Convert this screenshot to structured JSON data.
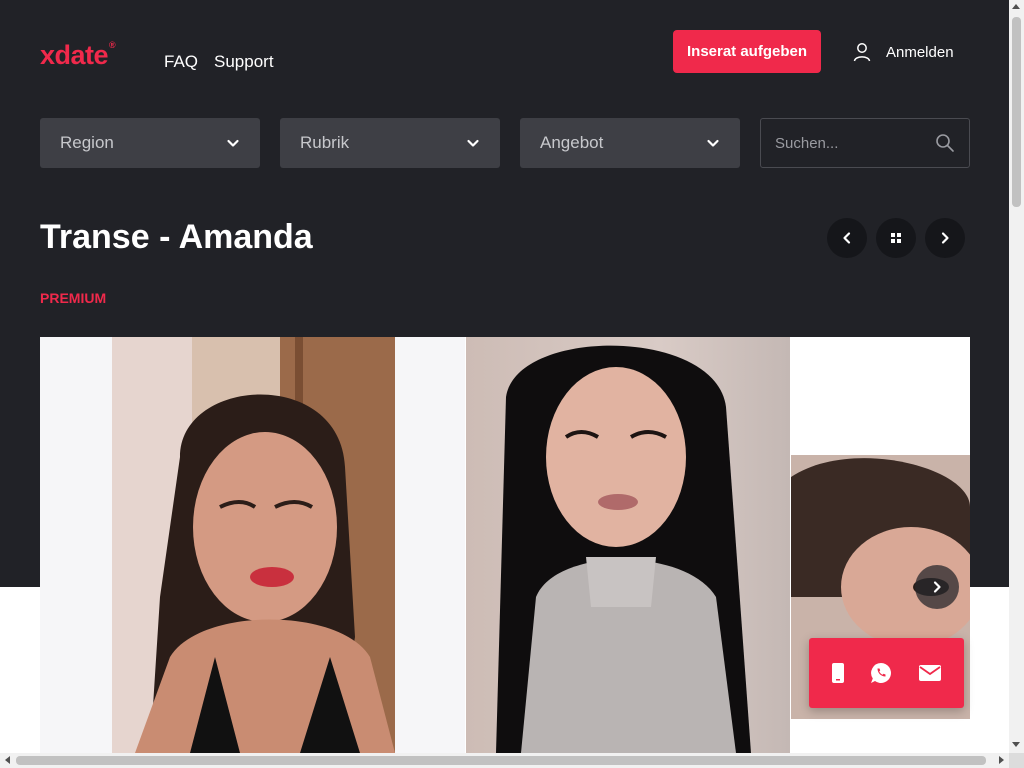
{
  "header": {
    "logo": "xdate",
    "logo_mark": "®",
    "nav": [
      "FAQ",
      "Support"
    ],
    "cta_label": "Inserat aufgeben",
    "login_label": "Anmelden"
  },
  "filters": {
    "region": "Region",
    "rubrik": "Rubrik",
    "angebot": "Angebot",
    "search_placeholder": "Suchen..."
  },
  "listing": {
    "title": "Transe - Amanda",
    "badge": "PREMIUM"
  },
  "icons": {
    "user": "user-icon",
    "chevron": "chevron-down-icon",
    "search": "search-icon",
    "prev": "chevron-left-icon",
    "grid": "grid-icon",
    "next": "chevron-right-icon",
    "phone": "phone-icon",
    "whatsapp": "whatsapp-icon",
    "mail": "mail-icon"
  },
  "colors": {
    "accent": "#f0294b",
    "dark_bg": "#212227",
    "select_bg": "#3e3f45"
  }
}
